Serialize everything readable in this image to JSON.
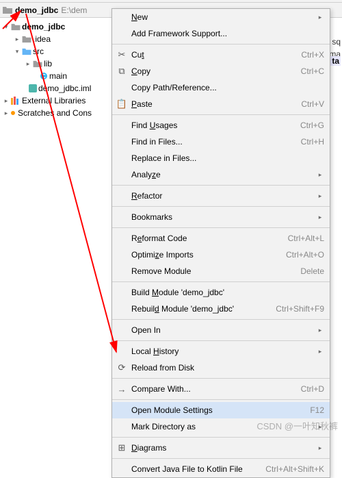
{
  "breadcrumb": {
    "name": "demo_jdbc",
    "path": "E:\\dem"
  },
  "tree": {
    "root": "demo_jdbc",
    "idea": ".idea",
    "src": "src",
    "lib": "lib",
    "main": "main",
    "iml": "demo_jdbc.iml",
    "ext": "External Libraries",
    "scratch": "Scratches and Cons"
  },
  "right": {
    "sq": "sq",
    "ma": "ma",
    "ta": "ta"
  },
  "menu": {
    "new": "New",
    "addfw": "Add Framework Support...",
    "cut": "Cut",
    "cut_sc": "Ctrl+X",
    "copy": "Copy",
    "copy_sc": "Ctrl+C",
    "copypath": "Copy Path/Reference...",
    "paste": "Paste",
    "paste_sc": "Ctrl+V",
    "findu": "Find Usages",
    "findu_sc": "Ctrl+G",
    "findf": "Find in Files...",
    "findf_sc": "Ctrl+H",
    "replf": "Replace in Files...",
    "analyze": "Analyze",
    "refactor": "Refactor",
    "bookmarks": "Bookmarks",
    "reformat": "Reformat Code",
    "reformat_sc": "Ctrl+Alt+L",
    "optimize": "Optimize Imports",
    "optimize_sc": "Ctrl+Alt+O",
    "remove": "Remove Module",
    "remove_sc": "Delete",
    "buildm": "Build Module 'demo_jdbc'",
    "rebuildm": "Rebuild Module 'demo_jdbc'",
    "rebuildm_sc": "Ctrl+Shift+F9",
    "openin": "Open In",
    "localh": "Local History",
    "reload": "Reload from Disk",
    "compare": "Compare With...",
    "compare_sc": "Ctrl+D",
    "openmod": "Open Module Settings",
    "openmod_sc": "F12",
    "markdir": "Mark Directory as",
    "diagrams": "Diagrams",
    "convert": "Convert Java File to Kotlin File",
    "convert_sc": "Ctrl+Alt+Shift+K"
  },
  "watermark": "CSDN @一叶知秋裤"
}
